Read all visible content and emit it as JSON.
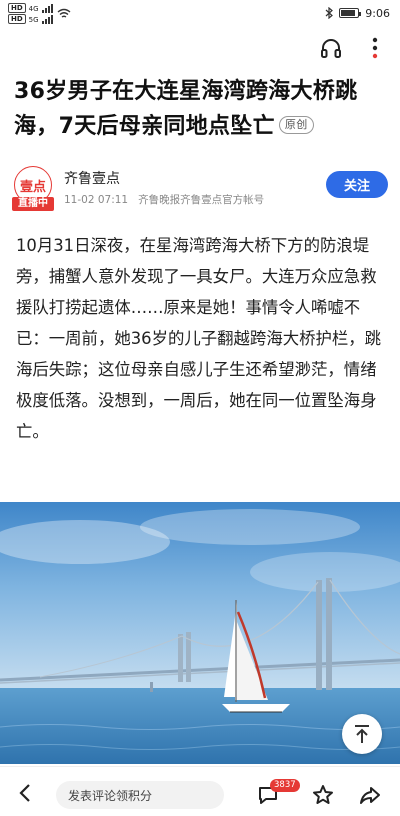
{
  "status_bar": {
    "sim1_tag": "HD",
    "sim1_net": "4G",
    "sim2_tag": "HD",
    "sim2_net": "5G",
    "time": "9:06",
    "battery_level": 0.85
  },
  "article": {
    "title": "36岁男子在大连星海湾跨海大桥跳海，7天后母亲同地点坠亡",
    "original_badge": "原创",
    "author": {
      "avatar_text": "壹点",
      "live_tag": "直播中",
      "name": "齐鲁壹点",
      "time": "11-02 07:11",
      "description": "齐鲁晚报齐鲁壹点官方帐号"
    },
    "follow_label": "关注",
    "body": "10月31日深夜，在星海湾跨海大桥下方的防浪堤旁，捕蟹人意外发现了一具女尸。大连万众应急救援队打捞起遗体……原来是她！事情令人唏嘘不已：一周前，她36岁的儿子翻越跨海大桥护栏，跳海后失踪；这位母亲自感儿子生还希望渺茫，情绪极度低落。没想到，一周后，她在同一位置坠海身亡。"
  },
  "bottom_bar": {
    "comment_placeholder": "发表评论领积分",
    "comment_count": "3837"
  },
  "colors": {
    "accent": "#2e6be6",
    "brand_red": "#e53935"
  },
  "icons": [
    "headphones-icon",
    "more-vertical-icon",
    "back-arrow-icon",
    "comment-icon",
    "star-icon",
    "share-icon",
    "scroll-top-icon",
    "bluetooth-icon",
    "wifi-icon",
    "signal-icon",
    "battery-icon"
  ]
}
